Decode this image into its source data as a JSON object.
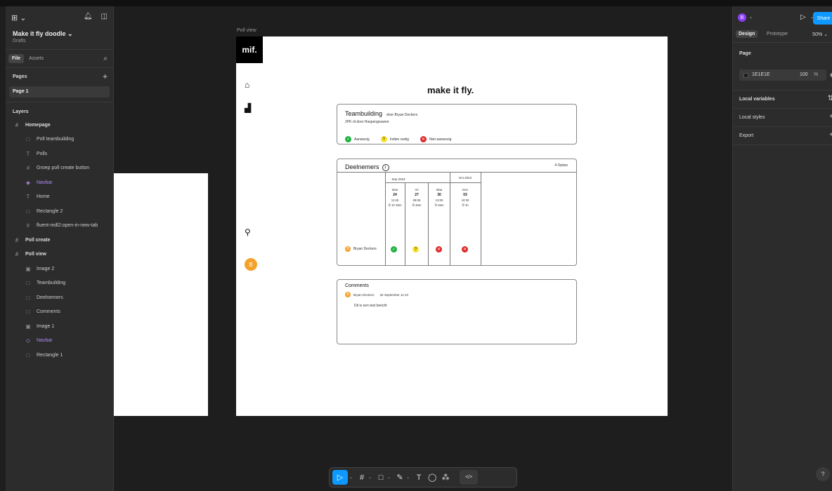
{
  "app": {
    "logo_icon": "figma-logo-icon",
    "logo_text": "⊞ ⌄",
    "file_name": "Make it fly doodle ⌄",
    "location": "Drafts"
  },
  "left_panel": {
    "tabs": [
      {
        "label": "File"
      },
      {
        "label": "Assets"
      }
    ],
    "pages_label": "Pages",
    "pages": [
      {
        "label": "Page 1"
      }
    ],
    "layers_label": "Layers",
    "layers": [
      {
        "label": "Homepage",
        "icon": "frame-icon",
        "level": 0
      },
      {
        "label": "Poll teambuilding",
        "icon": "rect-icon",
        "level": 1
      },
      {
        "label": "Polls",
        "icon": "text-icon",
        "level": 1
      },
      {
        "label": "Groep poll create button",
        "icon": "frame-icon",
        "level": 1
      },
      {
        "label": "Navbar",
        "icon": "component-icon",
        "level": 1
      },
      {
        "label": "Home",
        "icon": "text-icon",
        "level": 1
      },
      {
        "label": "Rectangle 2",
        "icon": "rect-icon",
        "level": 1
      },
      {
        "label": "fluent-mdl2:open-in-new-tab",
        "icon": "frame-icon",
        "level": 1
      },
      {
        "label": "Poll create",
        "icon": "frame-icon",
        "level": 0
      },
      {
        "label": "Poll view",
        "icon": "frame-icon",
        "level": 0
      },
      {
        "label": "Image 2",
        "icon": "image-icon",
        "level": 1
      },
      {
        "label": "Teambuilding",
        "icon": "rect-icon",
        "level": 1
      },
      {
        "label": "Deelnemers",
        "icon": "rect-icon",
        "level": 1
      },
      {
        "label": "Comments",
        "icon": "rect-icon",
        "level": 1
      },
      {
        "label": "Image 1",
        "icon": "image-icon",
        "level": 1
      },
      {
        "label": "Navbar",
        "icon": "instance-icon",
        "level": 1
      },
      {
        "label": "Rectangle 1",
        "icon": "rect-icon",
        "level": 1
      }
    ]
  },
  "canvas": {
    "frame_label": "Poll view",
    "navbar": {
      "logo": "mif.",
      "avatar": "B"
    },
    "brand": "make it fly.",
    "teambuilding": {
      "title": "Teambuilding",
      "by": "door Bryan Deckers",
      "subtitle": "2PK rit door Haspengouwen",
      "legend": [
        {
          "label": "Aanwezig",
          "status": "yes",
          "symbol": "✓"
        },
        {
          "label": "Indien nodig",
          "status": "maybe",
          "symbol": "?"
        },
        {
          "label": "Niet aanwezig",
          "status": "no",
          "symbol": "✕"
        }
      ]
    },
    "participants_card": {
      "title": "Deelnemers",
      "count": "1",
      "options": "4 Opties",
      "months": [
        "Sep 2024",
        "Oct 2024"
      ],
      "columns": [
        {
          "day": "Woe",
          "date": "24",
          "time": "11:45",
          "duration": "⏱ 1h 30m"
        },
        {
          "day": "Vri",
          "date": "27",
          "time": "08:05",
          "duration": "⏱ 45m"
        },
        {
          "day": "Maa",
          "date": "30",
          "time": "13:00",
          "duration": "⏱ 45m"
        },
        {
          "day": "Don",
          "date": "03",
          "time": "10:30",
          "duration": "⏱ 1h"
        }
      ],
      "participant": {
        "avatar": "B",
        "name": "Bryan Deckers",
        "votes": [
          "yes",
          "maybe",
          "no",
          "no"
        ]
      }
    },
    "comments": {
      "title": "Comments",
      "avatar": "B",
      "author": "Bryan Deckers",
      "date": "25 September 11:10",
      "text": "Dit is een test bericht"
    }
  },
  "toolbar": {
    "tools": [
      {
        "name": "move-tool",
        "glyph": "▷",
        "selected": true
      },
      {
        "name": "frame-tool",
        "glyph": "#"
      },
      {
        "name": "shape-tool",
        "glyph": "□"
      },
      {
        "name": "pen-tool",
        "glyph": "✎"
      },
      {
        "name": "text-tool",
        "glyph": "T"
      },
      {
        "name": "comment-tool",
        "glyph": "◯"
      },
      {
        "name": "actions-tool",
        "glyph": "⁂"
      }
    ],
    "code_label": "</>"
  },
  "right_panel": {
    "avatar": "B",
    "share_label": "Share",
    "tabs": [
      "Design",
      "Prototype"
    ],
    "zoom": "50% ⌄",
    "page_section": "Page",
    "page_fill": {
      "hex": "1E1E1E",
      "opacity": "100",
      "unit": "%"
    },
    "local_variables": "Local variables",
    "local_styles": "Local styles",
    "export": "Export",
    "help": "?"
  },
  "colors": {
    "accent": "#0d99ff",
    "yes": "#1fb141",
    "maybe": "#f7e02a",
    "no": "#e02a2a",
    "avatar": "#f4a12a"
  }
}
